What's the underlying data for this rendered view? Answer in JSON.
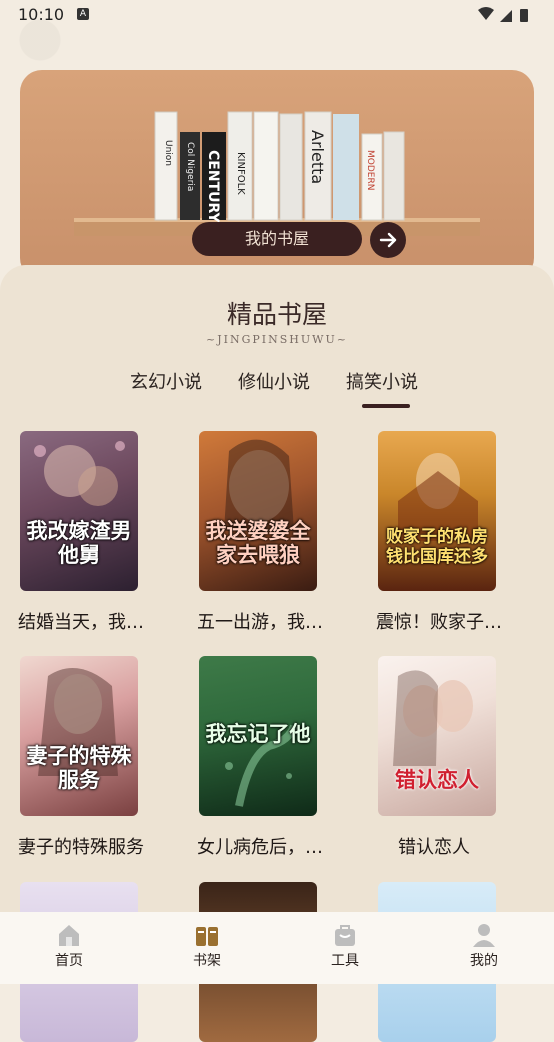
{
  "status": {
    "time": "10:10",
    "a_badge": "A"
  },
  "hero": {
    "my_shelf_label": "我的书屋"
  },
  "section": {
    "title": "精品书屋",
    "subtitle": "~JINGPINSHUWU~"
  },
  "tabs": [
    {
      "label": "玄幻小说",
      "active": false
    },
    {
      "label": "修仙小说",
      "active": false
    },
    {
      "label": "搞笑小说",
      "active": true
    }
  ],
  "books": [
    {
      "title": "结婚当天，我…",
      "cover_title": "我改嫁渣男他舅",
      "cover_top": "结婚当天",
      "cover_colors": [
        "#6e4a5f",
        "#2c2030"
      ]
    },
    {
      "title": "五一出游，我…",
      "cover_title": "我送婆婆全家去喂狼",
      "cover_top": "五一出游",
      "cover_colors": [
        "#a0552d",
        "#3a1c12"
      ]
    },
    {
      "title": "震惊！败家子…",
      "cover_title": "败家子的私房钱比国库还多",
      "cover_top": "震惊！",
      "cover_colors": [
        "#c9862a",
        "#5a2410"
      ]
    },
    {
      "title": "妻子的特殊服务",
      "cover_title": "妻子的特殊服务",
      "cover_top": "",
      "cover_colors": [
        "#d9a0a0",
        "#7a4040"
      ]
    },
    {
      "title": "女儿病危后，…",
      "cover_title": "我忘记了他",
      "cover_top": "女儿病危后",
      "cover_colors": [
        "#2f6a3c",
        "#0f2a18"
      ]
    },
    {
      "title": "错认恋人",
      "cover_title": "错认恋人",
      "cover_top": "",
      "cover_colors": [
        "#f0e0d8",
        "#c8a8a0"
      ]
    }
  ],
  "nav": [
    {
      "label": "首页",
      "icon": "home-icon",
      "active": false
    },
    {
      "label": "书架",
      "icon": "bookshelf-icon",
      "active": true
    },
    {
      "label": "工具",
      "icon": "toolbox-icon",
      "active": false
    },
    {
      "label": "我的",
      "icon": "profile-icon",
      "active": false
    }
  ],
  "colors": {
    "accent": "#3a2020",
    "panel": "#ede3d3",
    "hero": "#d8a37a",
    "active_icon": "#9a7030",
    "inactive_icon": "#b8b8b8"
  }
}
